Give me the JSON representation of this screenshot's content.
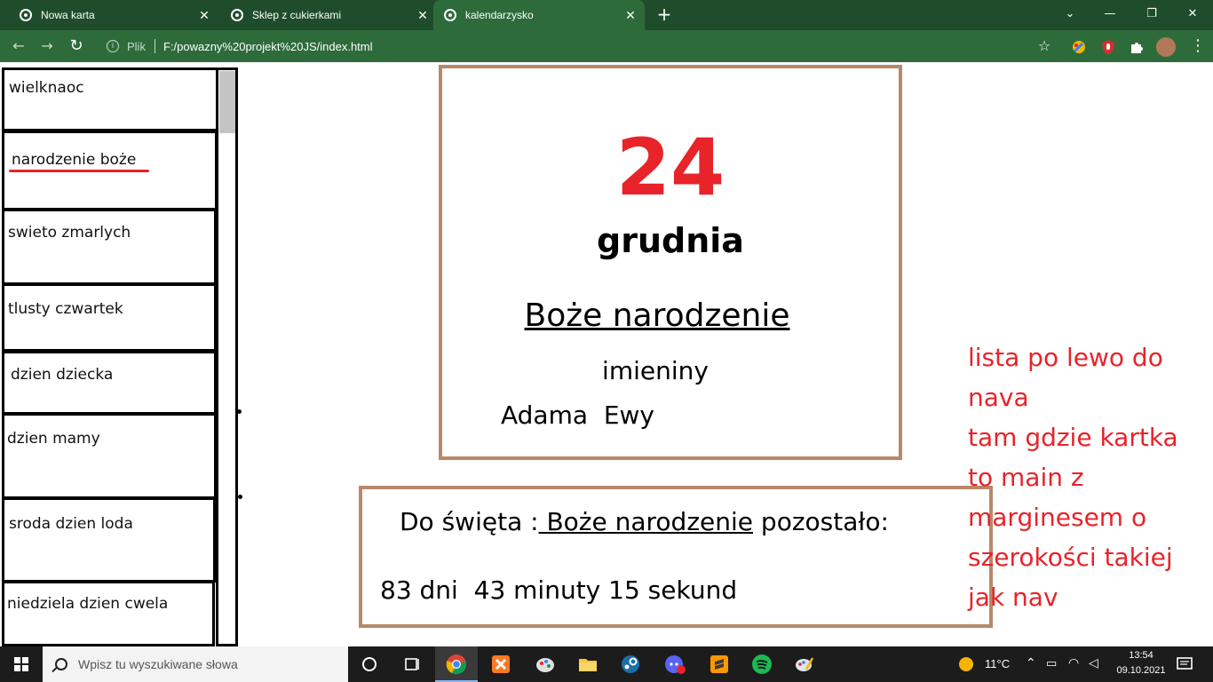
{
  "browser": {
    "tabs": [
      {
        "title": "Nowa karta",
        "active": false
      },
      {
        "title": "Sklep z cukierkami",
        "active": false
      },
      {
        "title": "kalendarzysko",
        "active": true
      }
    ],
    "new_tab": "+",
    "window_controls": {
      "minimize": "—",
      "maximize": "❐",
      "close": "✕",
      "tab_search": "⌄"
    },
    "nav": {
      "back": "←",
      "forward": "→",
      "reload": "↻"
    },
    "address": {
      "info": "i",
      "scheme_label": "Plik",
      "url": "F:/powazny%20projekt%20JS/index.html"
    },
    "bookmark_icon": "☆",
    "accent": "#1f4d2b"
  },
  "nav_list": {
    "items": [
      {
        "label": "wielknaoc"
      },
      {
        "label": "narodzenie boże"
      },
      {
        "label": "swieto zmarlych"
      },
      {
        "label": "tlusty czwartek"
      },
      {
        "label": "dzien dziecka"
      },
      {
        "label": "dzien mamy"
      },
      {
        "label": "sroda dzien loda"
      },
      {
        "label": "niedziela dzien cwela"
      }
    ]
  },
  "card": {
    "day": "24",
    "month": "grudnia",
    "holiday": "Boże narodzenie",
    "nameday_label": "imieniny",
    "names": "Adama  Ewy",
    "border_color": "#b7896a",
    "day_color": "#e8232a"
  },
  "countdown": {
    "prefix": "Do święta :",
    "holiday": " Boże narodzenie",
    "suffix": " pozostało:",
    "remaining": "83 dni  43 minuty 15 sekund"
  },
  "note": {
    "lines": [
      "lista po lewo do",
      "nava",
      "tam gdzie kartka",
      "to main z",
      "marginesem o",
      "szerokości takiej",
      "jak nav"
    ],
    "color": "#e8232a"
  },
  "taskbar": {
    "search_placeholder": "Wpisz tu wyszukiwane słowa",
    "weather": "11°C",
    "time": "13:54",
    "date": "09.10.2021",
    "apps": [
      "cortana-icon",
      "task-view-icon",
      "chrome-icon",
      "xampp-icon",
      "paint-icon",
      "file-explorer-icon",
      "steam-icon",
      "discord-icon",
      "sublime-text-icon",
      "spotify-icon",
      "paint-3d-icon"
    ]
  }
}
